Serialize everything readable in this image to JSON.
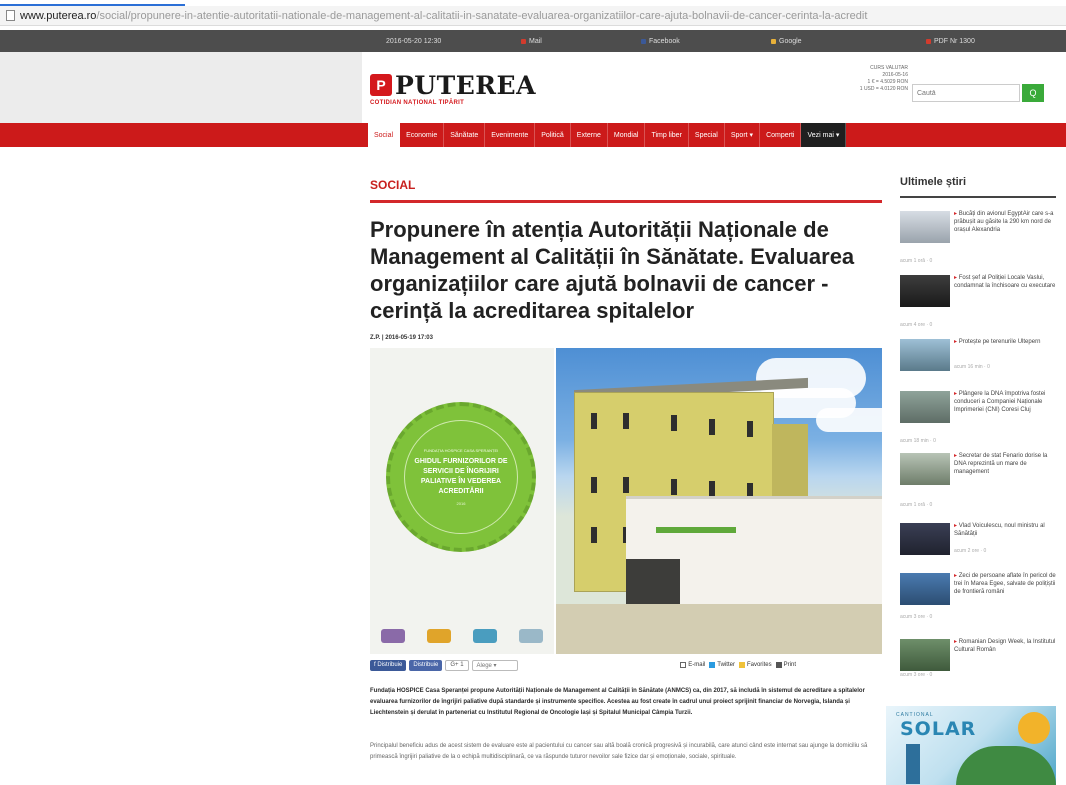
{
  "browser": {
    "url_host": "www.puterea.ro",
    "url_path": "/social/propunere-in-atentie-autoritatii-nationale-de-management-al-calitatii-in-sanatate-evaluarea-organizatiilor-care-ajuta-bolnavii-de-cancer-cerinta-la-acredit"
  },
  "topbar": {
    "date": "2016-05-20 12:30",
    "mail": "Mail",
    "facebook": "Facebook",
    "google": "Google",
    "pdf": "PDF Nr 1300"
  },
  "header": {
    "logo_mark": "P",
    "logo_text": "PUTEREA",
    "tagline": "COTIDIAN NAȚIONAL TIPĂRIT",
    "curs_title": "CURS VALUTAR",
    "curs_date": "2016-05-16",
    "curs_eur": "1 € = 4.5029 RON",
    "curs_usd": "1 USD = 4.0120 RON",
    "search_placeholder": "Caută",
    "search_button": "Q"
  },
  "nav": {
    "items": [
      "Social",
      "Economie",
      "Sănătate",
      "Evenimente",
      "Politică",
      "Externe",
      "Mondial",
      "Timp liber",
      "Special",
      "Sport ▾",
      "Comperti",
      "Vezi mai ▾"
    ]
  },
  "article": {
    "section": "SOCIAL",
    "title": "Propunere în atenția Autorității Naționale de Management al Calității în Sănătate. Evaluarea organizațiilor care ajută bolnavii de cancer - cerință la acreditarea spitalelor",
    "byline": "Z.P. | 2016-05-19 17:03",
    "badge_small": "FUNDAȚIA HOSPICE CASA SPERANȚEI",
    "badge_main": "GHIDUL FURNIZORILOR DE SERVICII DE ÎNGRIJIRI PALIATIVE ÎN VEDEREA ACREDITĂRII",
    "badge_year": "2016",
    "share": {
      "facebook": "f Distribuie",
      "facebook2": "Distribuie",
      "gplus": "G+ 1",
      "select": "Alege ▾",
      "email": "E-mail",
      "twitter": "Twitter",
      "favorites": "Favorites",
      "print": "Print"
    },
    "lead": "Fundația HOSPICE Casa Speranței propune Autorității Naționale de Management al Calității în Sănătate (ANMCS) ca, din 2017, să includă în sistemul de acreditare a spitalelor evaluarea furnizorilor de îngrijiri paliative după standarde și instrumente specifice. Acestea au fost create în cadrul unui proiect sprijinit financiar de Norvegia, Islanda și Liechtenstein și derulat în parteneriat cu Institutul Regional de Oncologie Iași și Spitalul Municipal Câmpia Turzii.",
    "body": "Principalul beneficiu adus de acest sistem de evaluare este al pacientului cu cancer sau altă boală cronică progresivă și incurabilă, care atunci când este internat sau ajunge la domiciliu să primească îngrijiri paliative de la o echipă multidisciplinară, ce va răspunde tuturor nevoilor sale fizice dar și emoționale, sociale, spirituale."
  },
  "sidebar": {
    "title": "Ultimele știri",
    "items": [
      {
        "title": "Bucăți din avionul EgyptAir care s-a prăbușit au găsite la 290 km nord de orașul Alexandria",
        "meta": "acum 1 oră · 0"
      },
      {
        "title": "Fost șef al Poliției Locale Vaslui, condamnat la închisoare cu executare",
        "meta": "acum 4 ore · 0"
      },
      {
        "title": "Protește pe terenurile Ultepern",
        "meta": "acum 16 min · 0"
      },
      {
        "title": "Plângere la DNA împotriva fostei conduceri a Companiei Naționale Imprimeriei (CNI) Coresi Cluj",
        "meta": "acum 18 min · 0"
      },
      {
        "title": "Secretar de stat Fenario dorise la DNA reprezintă un mare de management",
        "meta": "acum 1 oră · 0"
      },
      {
        "title": "Vlad Voiculescu, noul ministru al Sănătății",
        "meta": "acum 2 ore · 0"
      },
      {
        "title": "Zeci de persoane aflate în pericol de trei în Marea Egee, salvate de polițiștii de frontieră români",
        "meta": "acum 3 ore · 0"
      },
      {
        "title": "Romanian Design Week, la Institutul Cultural Român",
        "meta": "acum 3 ore · 0"
      }
    ]
  },
  "ad": {
    "label": "CANTIONAL",
    "title": "SOLAR"
  },
  "colors": {
    "brand_red": "#cc1a1a",
    "accent_green": "#3aaa3a",
    "top_strip": "#4d4d4d"
  }
}
